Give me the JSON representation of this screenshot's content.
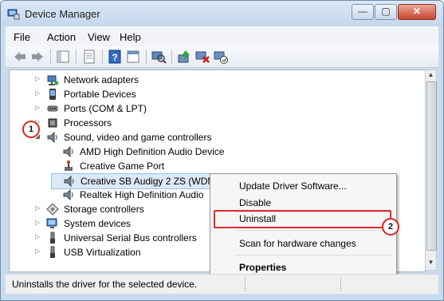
{
  "window": {
    "title": "Device Manager"
  },
  "title_controls": {
    "minimize": "—",
    "maximize": "▢",
    "close": "✕"
  },
  "menubar": {
    "items": [
      "File",
      "Action",
      "View",
      "Help"
    ]
  },
  "toolbar": {
    "icons": [
      "back-arrow-icon",
      "forward-arrow-icon",
      "tree-view-icon",
      "properties-icon",
      "help-icon",
      "window-icon",
      "scan-icon",
      "update-driver-icon",
      "uninstall-icon",
      "enable-icon"
    ]
  },
  "tree": {
    "items": [
      {
        "label": "Network adapters",
        "icon": "network-icon",
        "level": 0,
        "expander": "▷"
      },
      {
        "label": "Portable Devices",
        "icon": "portable-icon",
        "level": 0,
        "expander": "▷"
      },
      {
        "label": "Ports (COM & LPT)",
        "icon": "port-icon",
        "level": 0,
        "expander": "▷"
      },
      {
        "label": "Processors",
        "icon": "processor-icon",
        "level": 0,
        "expander": "▷"
      },
      {
        "label": "Sound, video and game controllers",
        "icon": "speaker-icon",
        "level": 0,
        "expander": "◢"
      },
      {
        "label": "AMD High Definition Audio Device",
        "icon": "speaker-icon",
        "level": 1
      },
      {
        "label": "Creative Game Port",
        "icon": "gameport-icon",
        "level": 1
      },
      {
        "label": "Creative SB Audigy 2 ZS (WDM)",
        "icon": "speaker-icon",
        "level": 1,
        "selected": true
      },
      {
        "label": "Realtek High Definition Audio",
        "icon": "speaker-icon",
        "level": 1
      },
      {
        "label": "Storage controllers",
        "icon": "storage-icon",
        "level": 0,
        "expander": "▷"
      },
      {
        "label": "System devices",
        "icon": "system-icon",
        "level": 0,
        "expander": "▷"
      },
      {
        "label": "Universal Serial Bus controllers",
        "icon": "usb-icon",
        "level": 0,
        "expander": "▷"
      },
      {
        "label": "USB Virtualization",
        "icon": "usb-icon",
        "level": 0,
        "expander": "▷"
      }
    ]
  },
  "context_menu": {
    "items": [
      {
        "label": "Update Driver Software...",
        "bold": false
      },
      {
        "label": "Disable",
        "bold": false
      },
      {
        "label": "Uninstall",
        "bold": false,
        "highlighted": true
      },
      {
        "label": "Scan for hardware changes",
        "bold": false
      },
      {
        "label": "Properties",
        "bold": true
      }
    ]
  },
  "annotations": {
    "step1": "1",
    "step2": "2",
    "highlight_color": "#e02b2b"
  },
  "statusbar": {
    "text": "Uninstalls the driver for the selected device."
  }
}
